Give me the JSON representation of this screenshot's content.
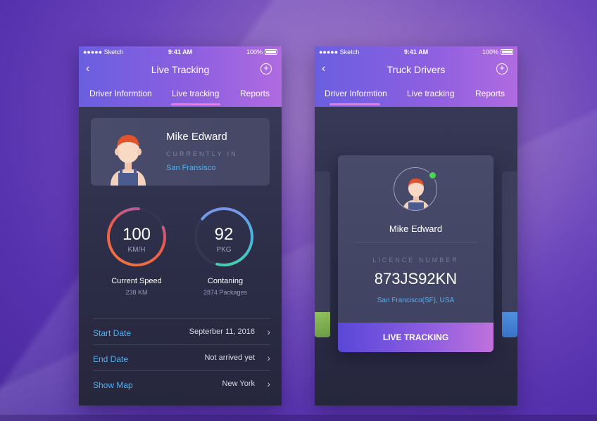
{
  "colors": {
    "accent_blue": "#4fb0f2",
    "header_start": "#6a5fe0",
    "header_end": "#b06be0",
    "online": "#4cd35a",
    "tab_indicator": "#f07ad8"
  },
  "status_bar": {
    "carrier": "●●●●● Sketch",
    "time": "9:41 AM",
    "battery": "100%"
  },
  "left_screen": {
    "title": "Live Tracking",
    "back_icon": "chevron-left-icon",
    "add_icon": "plus-circle-icon",
    "tabs": [
      {
        "label": "Driver Informtion"
      },
      {
        "label": "Live tracking",
        "active": true
      },
      {
        "label": "Reports"
      }
    ],
    "driver": {
      "name": "Mike Edward",
      "status_label": "CURRENTLY IN",
      "city": "San Fransisco"
    },
    "speed": {
      "value": "100",
      "unit": "KM/H",
      "label": "Current Speed",
      "sub": "238 KM"
    },
    "packages": {
      "value": "92",
      "unit": "PKG",
      "label": "Contaning",
      "sub": "2874 Packages"
    },
    "details": [
      {
        "label": "Start Date",
        "value": "Septerber 11, 2016"
      },
      {
        "label": "End Date",
        "value": "Not arrived yet"
      },
      {
        "label": "Show Map",
        "value": "New York"
      }
    ],
    "chevron": "›"
  },
  "right_screen": {
    "title": "Truck Drivers",
    "back_icon": "chevron-left-icon",
    "add_icon": "plus-circle-icon",
    "tabs": [
      {
        "label": "Driver Informtion",
        "active": true
      },
      {
        "label": "Live tracking"
      },
      {
        "label": "Reports"
      }
    ],
    "card": {
      "name": "Mike Edward",
      "licence_label": "LICENCE NUMBER",
      "licence_number": "873JS92KN",
      "location": "San Francisco(SF), USA",
      "button_label": "LIVE TRACKING"
    }
  }
}
